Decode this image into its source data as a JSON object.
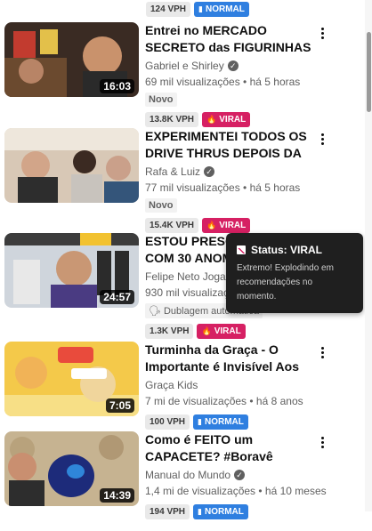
{
  "top_badges": {
    "vph": "124 VPH",
    "tag": "NORMAL"
  },
  "videos": [
    {
      "title": "Entrei no MERCADO SECRETO das FIGURINHAS FALSAS DA ...",
      "channel": "Gabriel e Shirley",
      "stats": "69 mil visualizações • há 5 horas",
      "extra": "Novo",
      "duration": "16:03",
      "vph": "13.8K VPH",
      "tag": "VIRAL"
    },
    {
      "title": "EXPERIMENTEI TODOS OS DRIVE THRUS DEPOIS DA ...",
      "channel": "Rafa & Luiz",
      "stats": "77 mil visualizações • há 5 horas",
      "extra": "Novo",
      "duration": "",
      "vph": "15.4K VPH",
      "tag": "VIRAL"
    },
    {
      "title": "ESTOU PRESO NO METRÔ COM 30 ANOMALIAS",
      "channel": "Felipe Neto Joga",
      "stats": "930 mil visualizações",
      "extra": "Dublagem automática",
      "duration": "24:57",
      "vph": "1.3K VPH",
      "tag": "VIRAL"
    },
    {
      "title": "Turminha da Graça - O Importante é Invisível Aos ...",
      "channel": "Graça Kids",
      "stats": "7 mi de visualizações • há 8 anos",
      "extra": "",
      "duration": "7:05",
      "vph": "100 VPH",
      "tag": "NORMAL"
    },
    {
      "title": "Como é FEITO um CAPACETE? #Boravê",
      "channel": "Manual do Mundo",
      "stats": "1,4 mi de visualizações • há 10 meses",
      "extra": "",
      "duration": "14:39",
      "vph": "194 VPH",
      "tag": "NORMAL"
    }
  ],
  "tooltip": {
    "title": "Status: VIRAL",
    "body": "Extremo! Explodindo em recomendações no momento."
  },
  "colors": {
    "normal": "#2f7fe0",
    "viral": "#d62063",
    "tooltip_bg": "#1f1f1f"
  }
}
